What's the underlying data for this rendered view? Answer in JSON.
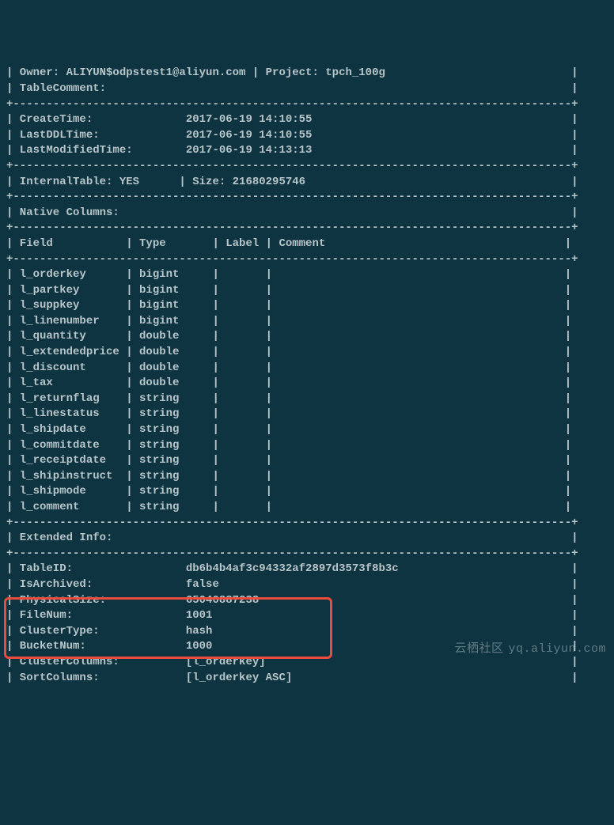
{
  "header": {
    "owner_label": "Owner:",
    "owner_value": "ALIYUN$odpstest1@aliyun.com",
    "project_label": "Project:",
    "project_value": "tpch_100g",
    "table_comment_label": "TableComment:"
  },
  "times": {
    "create_label": "CreateTime:",
    "create_value": "2017-06-19 14:10:55",
    "lastddl_label": "LastDDLTime:",
    "lastddl_value": "2017-06-19 14:10:55",
    "lastmod_label": "LastModifiedTime:",
    "lastmod_value": "2017-06-19 14:13:13"
  },
  "internal": {
    "internal_label": "InternalTable:",
    "internal_value": "YES",
    "size_label": "Size:",
    "size_value": "21680295746"
  },
  "native_columns_label": "Native Columns:",
  "columns_header": {
    "field": "Field",
    "type": "Type",
    "label": "Label",
    "comment": "Comment"
  },
  "columns": [
    {
      "field": "l_orderkey",
      "type": "bigint"
    },
    {
      "field": "l_partkey",
      "type": "bigint"
    },
    {
      "field": "l_suppkey",
      "type": "bigint"
    },
    {
      "field": "l_linenumber",
      "type": "bigint"
    },
    {
      "field": "l_quantity",
      "type": "double"
    },
    {
      "field": "l_extendedprice",
      "type": "double"
    },
    {
      "field": "l_discount",
      "type": "double"
    },
    {
      "field": "l_tax",
      "type": "double"
    },
    {
      "field": "l_returnflag",
      "type": "string"
    },
    {
      "field": "l_linestatus",
      "type": "string"
    },
    {
      "field": "l_shipdate",
      "type": "string"
    },
    {
      "field": "l_commitdate",
      "type": "string"
    },
    {
      "field": "l_receiptdate",
      "type": "string"
    },
    {
      "field": "l_shipinstruct",
      "type": "string"
    },
    {
      "field": "l_shipmode",
      "type": "string"
    },
    {
      "field": "l_comment",
      "type": "string"
    }
  ],
  "extended_label": "Extended Info:",
  "extended": {
    "tableid_label": "TableID:",
    "tableid_value": "db6b4b4af3c94332af2897d3573f8b3c",
    "isarchived_label": "IsArchived:",
    "isarchived_value": "false",
    "physicalsize_label": "PhysicalSize:",
    "physicalsize_value": "65040887238",
    "filenum_label": "FileNum:",
    "filenum_value": "1001",
    "clustertype_label": "ClusterType:",
    "clustertype_value": "hash",
    "bucketnum_label": "BucketNum:",
    "bucketnum_value": "1000",
    "clustercols_label": "ClusterColumns:",
    "clustercols_value": "[l_orderkey]",
    "sortcols_label": "SortColumns:",
    "sortcols_value": "[l_orderkey ASC]"
  },
  "watermark": {
    "cn": "云栖社区",
    "url": "yq.aliyun.com"
  },
  "border": {
    "dashplus": "+------------------------------------------------------------------------------------+",
    "col_sep": "+------------------------------------------------------------------------------------+"
  }
}
